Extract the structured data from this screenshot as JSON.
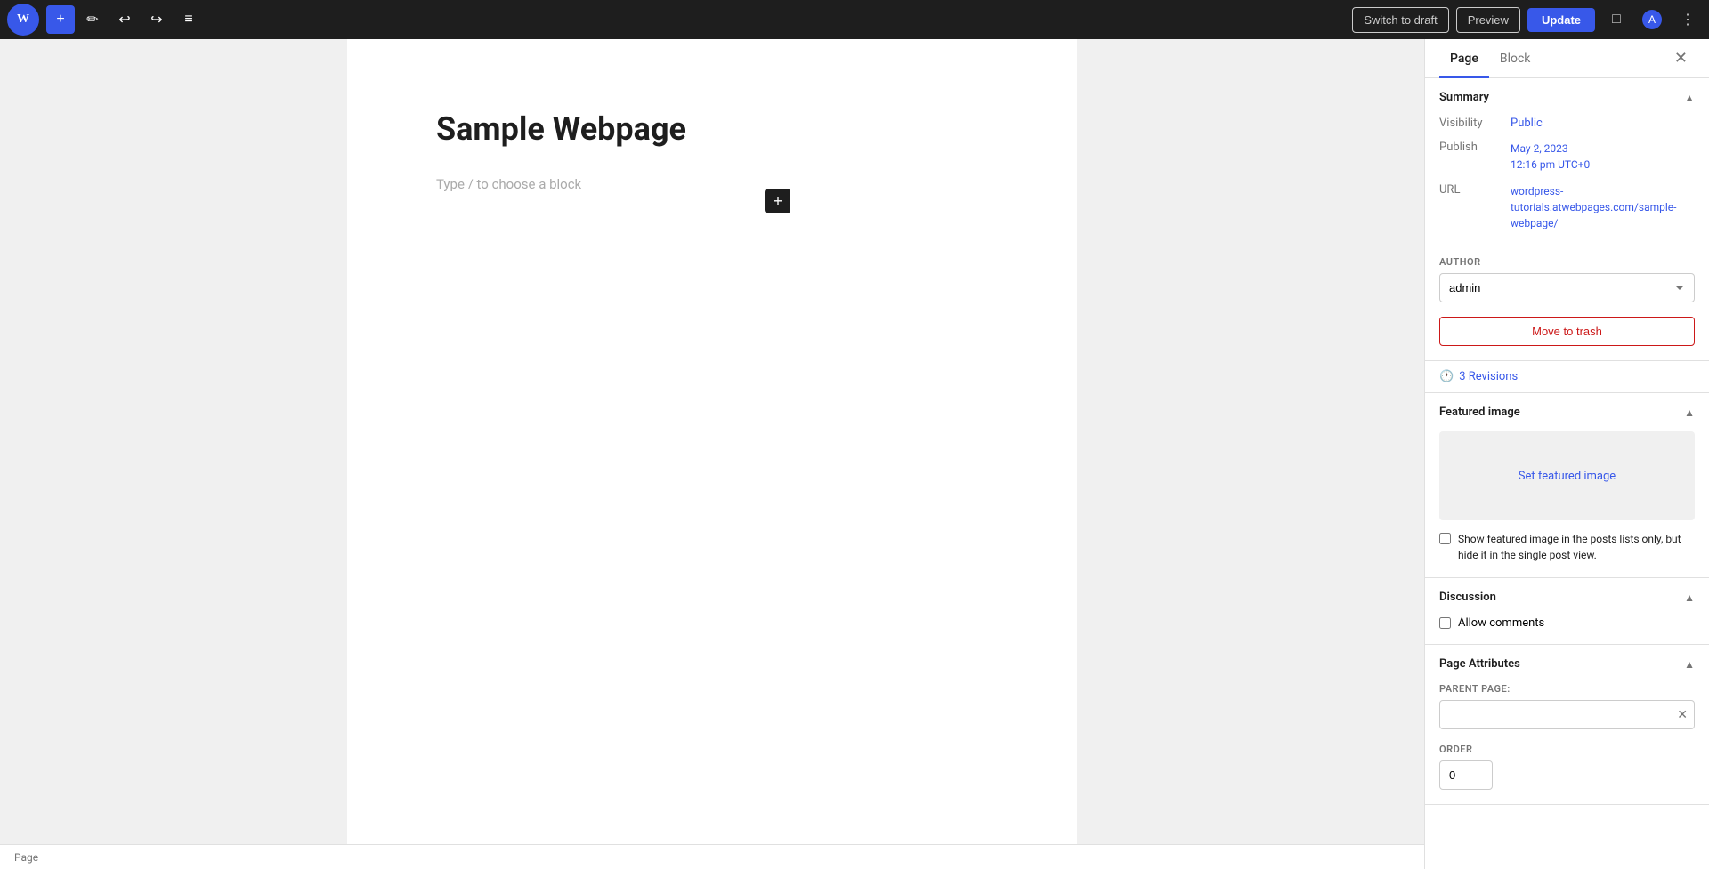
{
  "toolbar": {
    "wp_logo": "W",
    "add_label": "+",
    "edit_label": "✏",
    "undo_label": "↩",
    "redo_label": "↪",
    "tools_label": "≡",
    "switch_to_draft": "Switch to draft",
    "preview": "Preview",
    "update": "Update",
    "view_icon": "⊡",
    "user_icon": "⊙",
    "more_icon": "⋮"
  },
  "editor": {
    "page_title": "Sample Webpage",
    "block_placeholder": "Type / to choose a block"
  },
  "sidebar": {
    "tab_page": "Page",
    "tab_block": "Block",
    "close_icon": "✕",
    "summary_title": "Summary",
    "visibility_label": "Visibility",
    "visibility_value": "Public",
    "publish_label": "Publish",
    "publish_value": "May 2, 2023",
    "publish_time": "12:16 pm UTC+0",
    "url_label": "URL",
    "url_value": "wordpress-tutorials.atwebpages.com/sample-webpage/",
    "author_label": "AUTHOR",
    "author_value": "admin",
    "author_options": [
      "admin"
    ],
    "move_to_trash": "Move to trash",
    "revisions_icon": "🕐",
    "revisions_text": "3 Revisions",
    "featured_image_title": "Featured image",
    "set_featured_image": "Set featured image",
    "featured_image_checkbox_text": "Show featured image in the posts lists only, but hide it in the single post view.",
    "discussion_title": "Discussion",
    "allow_comments_label": "Allow comments",
    "page_attributes_title": "Page Attributes",
    "parent_page_label": "PARENT PAGE:",
    "order_label": "ORDER",
    "order_value": "0"
  },
  "status_bar": {
    "page_label": "Page"
  }
}
